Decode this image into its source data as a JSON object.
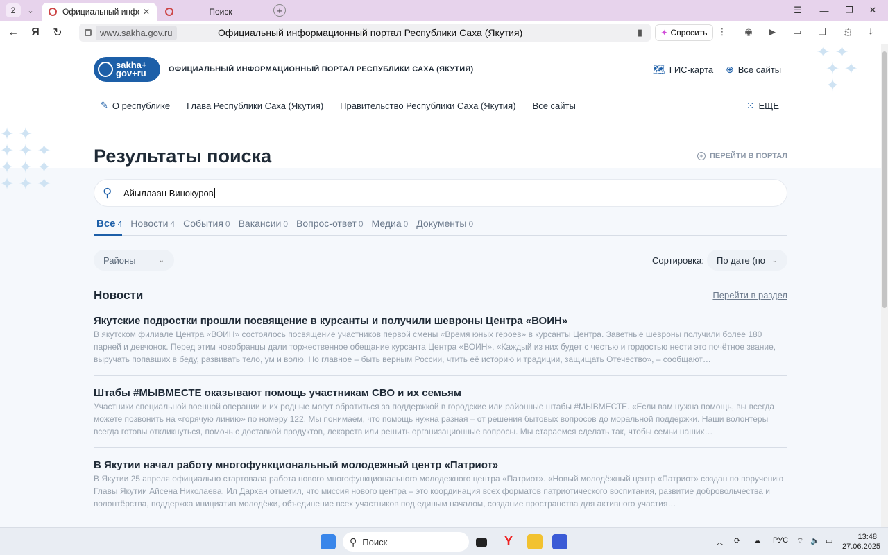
{
  "browser": {
    "tab_count": "2",
    "tabs": [
      {
        "title": "Официальный информ",
        "active": true
      },
      {
        "title": "Поиск",
        "active": false
      }
    ],
    "url_host": "www.sakha.gov.ru",
    "page_title": "Официальный информационный портал Республики Саха (Якутия)",
    "ask_label": "Спросить"
  },
  "header": {
    "logo_line1": "sakha+",
    "logo_line2": "gov+ru",
    "site_name": "ОФИЦИАЛЬНЫЙ ИНФОРМАЦИОННЫЙ ПОРТАЛ РЕСПУБЛИКИ САХА (ЯКУТИЯ)",
    "gis_label": "ГИС-карта",
    "all_sites_label": "Все сайты"
  },
  "nav": {
    "items": [
      "О республике",
      "Глава Республики Саха (Якутия)",
      "Правительство Республики Саха (Якутия)",
      "Все сайты"
    ],
    "more_label": "ЕЩЕ"
  },
  "search": {
    "heading": "Результаты поиска",
    "go_portal": "ПЕРЕЙТИ В ПОРТАЛ",
    "query": "Айыллаан Винокуров"
  },
  "filter_tabs": [
    {
      "label": "Все",
      "count": "4",
      "active": true
    },
    {
      "label": "Новости",
      "count": "4"
    },
    {
      "label": "События",
      "count": "0"
    },
    {
      "label": "Вакансии",
      "count": "0"
    },
    {
      "label": "Вопрос-ответ",
      "count": "0"
    },
    {
      "label": "Медиа",
      "count": "0"
    },
    {
      "label": "Документы",
      "count": "0"
    }
  ],
  "filters": {
    "district_label": "Районы",
    "sort_label": "Сортировка:",
    "sort_value": "По дате (по у"
  },
  "news": {
    "section_title": "Новости",
    "section_link": "Перейти в раздел",
    "items": [
      {
        "title": "Якутские подростки прошли посвящение в курсанты и получили шевроны Центра «ВОИН»",
        "text": "В якутском филиале Центра «ВОИН» состоялось посвящение участников первой смены «Время юных героев» в курсанты Центра. Заветные шевроны получили более 180 парней и девчонок. Перед этим новобранцы дали торжественное обещание курсанта Центра «ВОИН». «Каждый из них будет с честью и гордостью нести это почётное звание, выручать попавших в беду, развивать тело, ум и волю. Но главное – быть верным России, чтить её историю и традиции, защищать Отечество», – сообщают…"
      },
      {
        "title": "Штабы #МЫВМЕСТЕ оказывают помощь участникам СВО и их семьям",
        "text": "Участники специальной военной операции и их родные могут обратиться за поддержкой в городские или районные штабы #МЫВМЕСТЕ.  «Если вам нужна помощь, вы всегда можете позвонить на «горячую линию» по номеру 122. Мы понимаем, что помощь нужна разная – от решения бытовых вопросов до моральной поддержки. Наши волонтеры всегда готовы откликнуться, помочь с доставкой продуктов, лекарств или решить организационные вопросы. Мы стараемся сделать так, чтобы семьи наших…"
      },
      {
        "title": "В Якутии начал работу многофункциональный молодежный центр «Патриот»",
        "text": "В Якутии 25 апреля официально стартовала работа нового многофункционального молодежного центра «Патриот». «Новый молодёжный центр «Патриот» создан по поручению Главы Якутии Айсена Николаева. Ил Дархан отметил, что миссия нового центра – это координация всех форматов патриотического воспитания, развитие добровольчества и волонтёрства, поддержка инициатив молодёжи, объединение всех участников под единым началом, создание пространства для активного участия…"
      }
    ]
  },
  "taskbar": {
    "search_placeholder": "Поиск",
    "lang": "РУС",
    "time": "13:48",
    "date": "27.06.2025"
  },
  "colors": {
    "brand": "#1d5fa8",
    "tabstrip": "#e7d3ec"
  }
}
